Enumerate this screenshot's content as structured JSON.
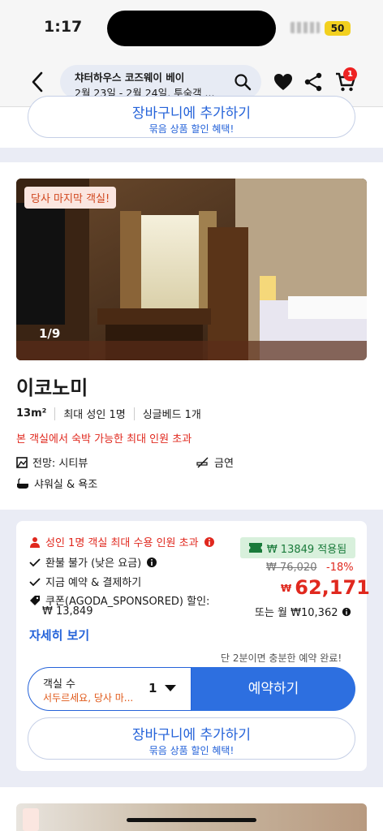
{
  "status_bar": {
    "time": "1:17",
    "battery": "50"
  },
  "header": {
    "title": "챠터하우스 코즈웨이 베이",
    "subtitle": "2월 23일 - 2월 24일, 투숙객 ...",
    "cart_count": "1"
  },
  "top_card": {
    "cart_label": "장바구니에 추가하기",
    "cart_sub": "묶음 상품 할인 혜택!"
  },
  "room": {
    "badge": "당사 마지막 객실!",
    "photo_count": "1/9",
    "title": "이코노미",
    "size": "13m²",
    "occupancy": "최대 성인 1명",
    "bed": "싱글베드 1개",
    "warning": "본 객실에서 숙박 가능한 최대 인원 초과",
    "amenities": [
      {
        "icon": "view-icon",
        "label": "전망: 시티뷰"
      },
      {
        "icon": "no-smoking-icon",
        "label": "금연"
      },
      {
        "icon": "bathtub-icon",
        "label": "샤워실 & 욕조"
      }
    ]
  },
  "offer": {
    "capacity_warning": "성인 1명 객실 최대 수용 인원 초과",
    "refund": "환불 불가 (낮은 요금)",
    "pay_now": "지금 예약 & 결제하기",
    "coupon_line1": "쿠폰(AGODA_SPONSORED) 할인:",
    "coupon_line2": "₩ 13,849",
    "promo": "₩ 13849 적용됨",
    "original_price": "₩ 76,020",
    "discount": "-18%",
    "currency": "₩",
    "price": "62,171",
    "monthly": "또는 월 ₩10,362",
    "details_link": "자세히 보기",
    "hint": "단 2분이면 충분한 예약 완료!",
    "room_select_label": "객실 수",
    "room_select_sub": "서두르세요, 당사 마...",
    "room_count": "1",
    "book_label": "예약하기",
    "cart_label": "장바구니에 추가하기",
    "cart_sub": "묶음 상품 할인 혜택!"
  },
  "colors": {
    "accent": "#2d6fe0",
    "red": "#e0281e",
    "promo_green": "#197a3a"
  }
}
